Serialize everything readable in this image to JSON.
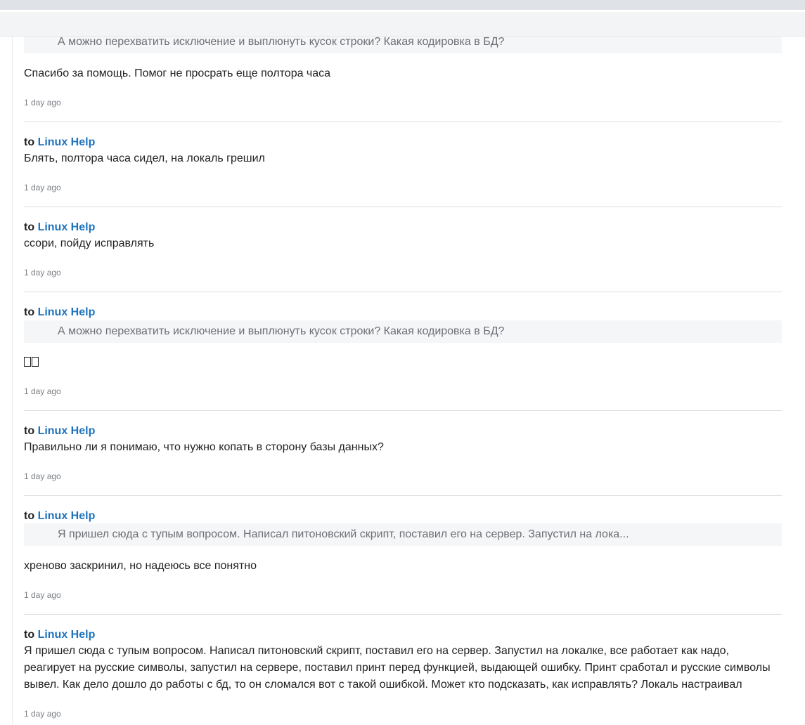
{
  "messages": [
    {
      "quote": "А можно перехватить исключение и выплюнуть кусок строки? Какая кодировка в БД?",
      "text": "Спасибо за помощь. Помог не просрать еще полтора часа",
      "time": "1 day ago"
    },
    {
      "to_prefix": "to",
      "to_target": "Linux Help",
      "text": "Блять, полтора часа сидел, на локаль грешил",
      "time": "1 day ago"
    },
    {
      "to_prefix": "to",
      "to_target": "Linux Help",
      "text": "ссори, пойду исправлять",
      "time": "1 day ago"
    },
    {
      "to_prefix": "to",
      "to_target": "Linux Help",
      "quote": "А можно перехватить исключение и выплюнуть кусок строки? Какая кодировка в БД?",
      "text": "",
      "time": "1 day ago"
    },
    {
      "to_prefix": "to",
      "to_target": "Linux Help",
      "text": "Правильно ли я понимаю, что нужно копать в сторону базы данных?",
      "time": "1 day ago"
    },
    {
      "to_prefix": "to",
      "to_target": "Linux Help",
      "quote": "Я пришел сюда с тупым вопросом. Написал питоновский скрипт, поставил его на сервер. Запустил на лока...",
      "text": "хреново заскринил, но надеюсь все понятно",
      "time": "1 day ago"
    },
    {
      "to_prefix": "to",
      "to_target": "Linux Help",
      "text": "Я пришел сюда с тупым вопросом. Написал питоновский скрипт, поставил его на сервер. Запустил на локалке, все работает как надо, реагирует на русские символы, запустил на сервере, поставил принт перед функцией, выдающей ошибку. Принт сработал и русские символы вывел. Как дело дошло до работы с бд, то он сломался вот с такой ошибкой. Может кто подсказать, как исправлять? Локаль настраивал",
      "time": "1 day ago"
    }
  ]
}
